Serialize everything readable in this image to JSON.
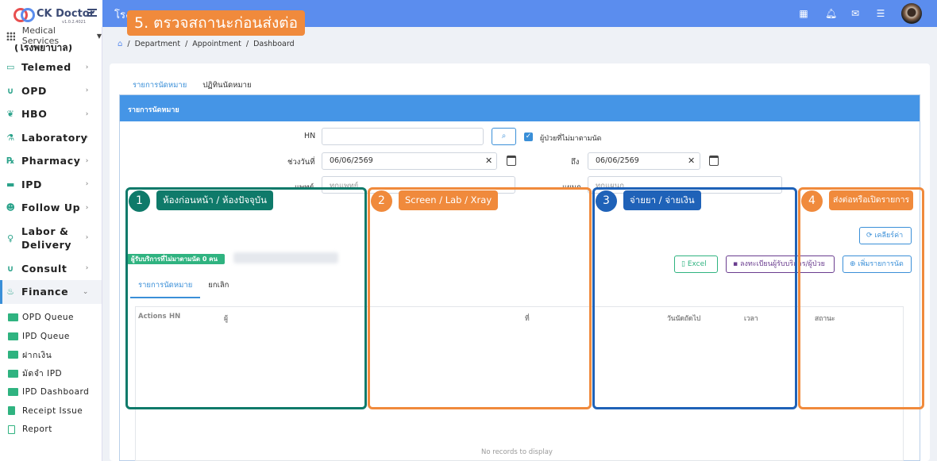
{
  "topbar": {
    "logo_text": "CK Doctor",
    "logo_version": "v1.0.2.4021",
    "hospital_title": "โรง"
  },
  "annotation_step5": "5. ตรวจสถานะก่อนส่งต่อ",
  "sidebar": {
    "module_selector": "Medical Services",
    "cut_item": "(โรงพยาบาล)",
    "items": [
      {
        "label": "Telemed",
        "icon": "video-icon"
      },
      {
        "label": "OPD",
        "icon": "stethoscope-icon"
      },
      {
        "label": "HBO",
        "icon": "leaf-icon"
      },
      {
        "label": "Laboratory",
        "icon": "flask-icon"
      },
      {
        "label": "Pharmacy",
        "icon": "rx-icon"
      },
      {
        "label": "IPD",
        "icon": "bed-icon"
      },
      {
        "label": "Follow Up",
        "icon": "user-check-icon"
      },
      {
        "label": "Labor & Delivery",
        "icon": "maternity-icon"
      },
      {
        "label": "Consult",
        "icon": "stethoscope-icon"
      },
      {
        "label": "Finance",
        "icon": "finance-icon"
      }
    ],
    "finance_sub": [
      "OPD Queue",
      "IPD Queue",
      "ฝากเงิน",
      "มัดจำ IPD",
      "IPD Dashboard",
      "Receipt Issue",
      "Report"
    ]
  },
  "breadcrumb": [
    "Department",
    "Appointment",
    "Dashboard"
  ],
  "tabs": [
    "รายการนัดหมาย",
    "ปฏิทินนัดหมาย"
  ],
  "panel_title": "รายการนัดหมาย",
  "form": {
    "hn_label": "HN",
    "hn_value": "",
    "no_show_label": "ผู้ป่วยที่ไม่มาตามนัด",
    "date_range_label": "ช่วงวันที่",
    "date_from": "06/06/2569",
    "to_label": "ถึง",
    "date_to": "06/06/2569",
    "doctor_label": "แพทย์",
    "doctor_value": "ทุกแพทย์",
    "dept_label": "แผนก",
    "dept_value": "ทุกแผนก"
  },
  "annotations": [
    {
      "num": "1",
      "label": "ห้องก่อนหน้า / ห้องปัจจุบัน",
      "color": "#0f7a6a"
    },
    {
      "num": "2",
      "label": "Screen / Lab / Xray",
      "color": "#f08a3c"
    },
    {
      "num": "3",
      "label": "จ่ายยา / จ่ายเงิน",
      "color": "#1f62b8"
    },
    {
      "num": "4",
      "label": "ส่งต่อหรือเปิดรายการ",
      "color": "#f08a3c"
    }
  ],
  "buttons": {
    "clear": "เคลียร์ค่า",
    "excel": "Excel",
    "register": "ลงทะเบียนผู้รับบริการ/ผู้ป่วย",
    "add": "เพิ่มรายการนัด"
  },
  "no_show_badge": "ผู้รับบริการที่ไม่มาตามนัด 0 คน",
  "subtabs": [
    "รายการนัดหมาย",
    "ยกเลิก"
  ],
  "table": {
    "headers": [
      "Actions",
      "HN",
      "ผู้",
      "ที่",
      "วันนัดถัดไป",
      "เวลา",
      "สถานะ"
    ],
    "empty": "No records to display"
  }
}
